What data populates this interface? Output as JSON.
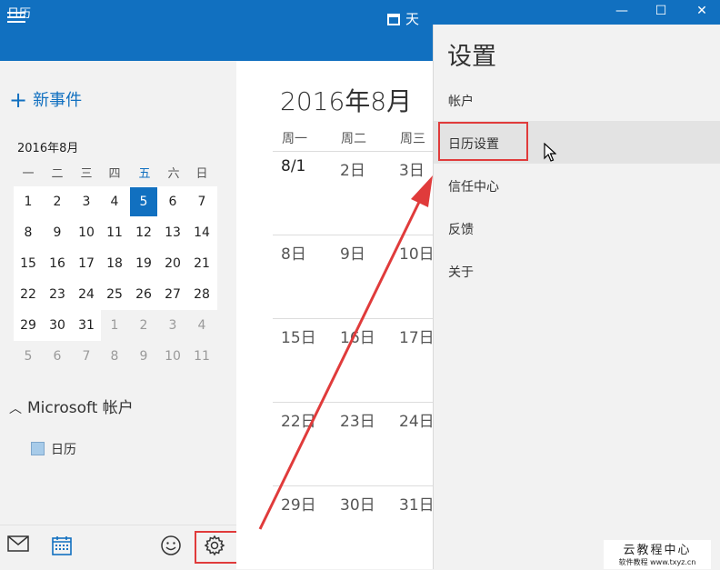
{
  "window": {
    "title": "日历"
  },
  "appbar": {
    "view_label": "天"
  },
  "sidebar": {
    "new_event": "新事件",
    "mini_month_title": "2016年8月",
    "weekdays": [
      "一",
      "二",
      "三",
      "四",
      "五",
      "六",
      "日"
    ],
    "weeks": [
      [
        "1",
        "2",
        "3",
        "4",
        "5",
        "6",
        "7"
      ],
      [
        "8",
        "9",
        "10",
        "11",
        "12",
        "13",
        "14"
      ],
      [
        "15",
        "16",
        "17",
        "18",
        "19",
        "20",
        "21"
      ],
      [
        "22",
        "23",
        "24",
        "25",
        "26",
        "27",
        "28"
      ],
      [
        "29",
        "30",
        "31",
        "1",
        "2",
        "3",
        "4"
      ],
      [
        "5",
        "6",
        "7",
        "8",
        "9",
        "10",
        "11"
      ]
    ],
    "account": "Microsoft 帐户",
    "calendar_item": "日历"
  },
  "main": {
    "month_title": "2016年8月",
    "col_headers": [
      "周一",
      "周二",
      "周三"
    ],
    "rows": [
      [
        "8/1",
        "2日",
        "3日"
      ],
      [
        "8日",
        "9日",
        "10日"
      ],
      [
        "15日",
        "16日",
        "17日"
      ],
      [
        "22日",
        "23日",
        "24日"
      ],
      [
        "29日",
        "30日",
        "31日"
      ]
    ]
  },
  "settings": {
    "title": "设置",
    "items": [
      "帐户",
      "日历设置",
      "信任中心",
      "反馈",
      "关于"
    ],
    "selected": "日历设置"
  },
  "watermark": {
    "line1": "云教程中心",
    "line2": "软件教程 www.txyz.cn"
  },
  "colors": {
    "accent": "#1170c0",
    "highlight": "#e03b3b"
  },
  "icons": {
    "mail": "mail-icon",
    "calendar": "calendar-icon",
    "feedback": "smiley-icon",
    "settings": "gear-icon"
  }
}
